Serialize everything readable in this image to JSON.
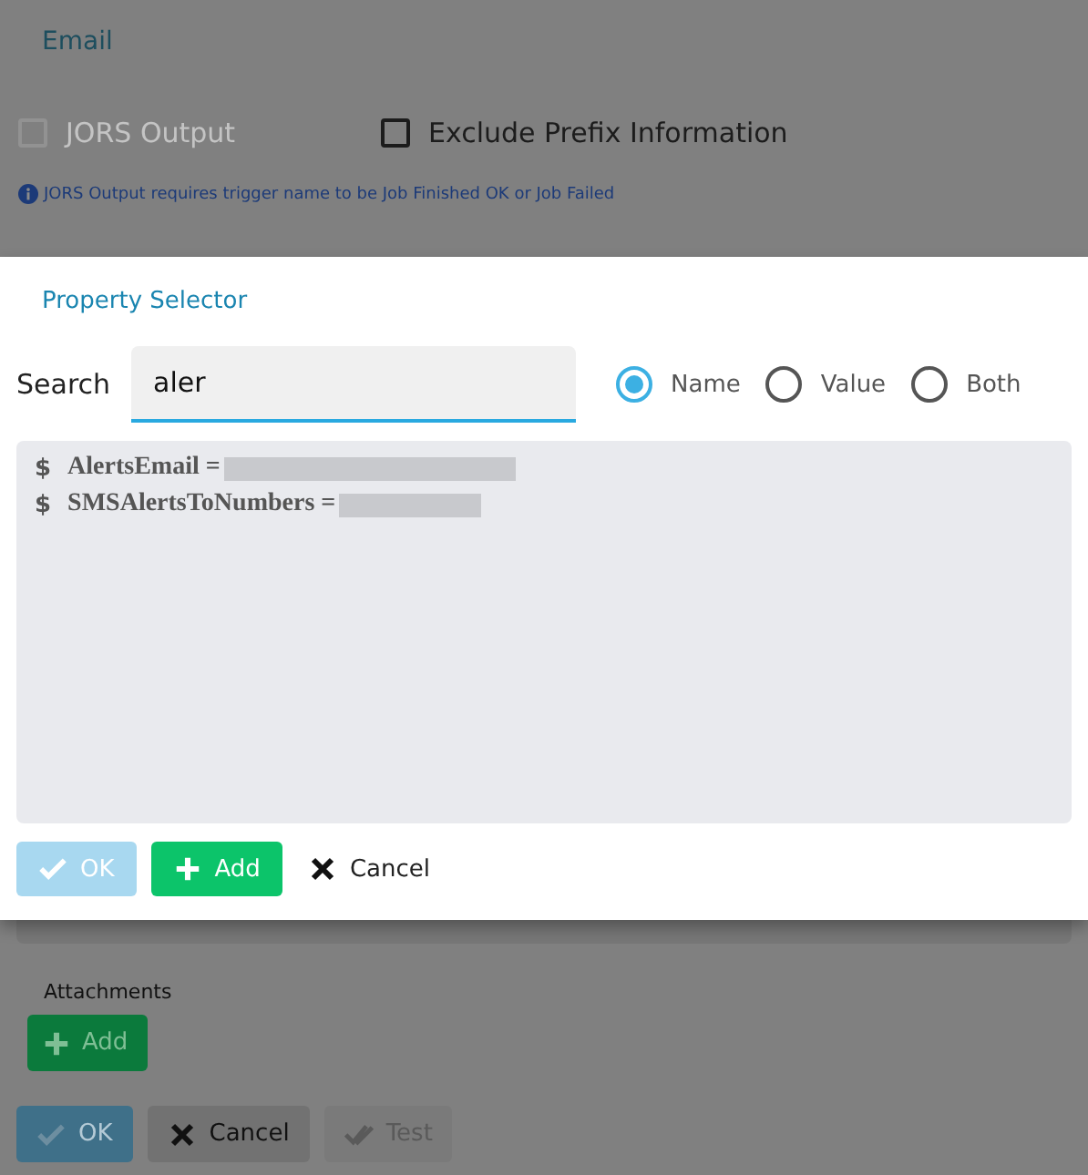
{
  "section_title": "Email",
  "options": [
    {
      "label": "JORS Output",
      "checked": false,
      "disabled": true
    },
    {
      "label": "Exclude Prefix Information",
      "checked": false,
      "disabled": false
    }
  ],
  "info_note": "JORS Output requires trigger name to be Job Finished OK or Job Failed",
  "dialog": {
    "title": "Property Selector",
    "search": {
      "label": "Search",
      "value": "aler"
    },
    "modes": [
      {
        "label": "Name",
        "selected": true
      },
      {
        "label": "Value",
        "selected": false
      },
      {
        "label": "Both",
        "selected": false
      }
    ],
    "results": [
      {
        "symbol": "$",
        "name": "AlertsEmail ="
      },
      {
        "symbol": "$",
        "name": "SMSAlertsToNumbers ="
      }
    ],
    "buttons": [
      {
        "kind": "ok",
        "label": "OK",
        "disabled": true
      },
      {
        "kind": "add",
        "label": "Add",
        "disabled": false
      },
      {
        "kind": "cancel",
        "label": "Cancel",
        "disabled": false
      }
    ]
  },
  "attachments": {
    "label": "Attachments",
    "button": "Add"
  },
  "footer_buttons": [
    {
      "kind": "ok",
      "label": "OK",
      "disabled": true
    },
    {
      "kind": "cancel",
      "label": "Cancel",
      "disabled": false
    },
    {
      "kind": "test",
      "label": "Test",
      "disabled": true
    }
  ]
}
